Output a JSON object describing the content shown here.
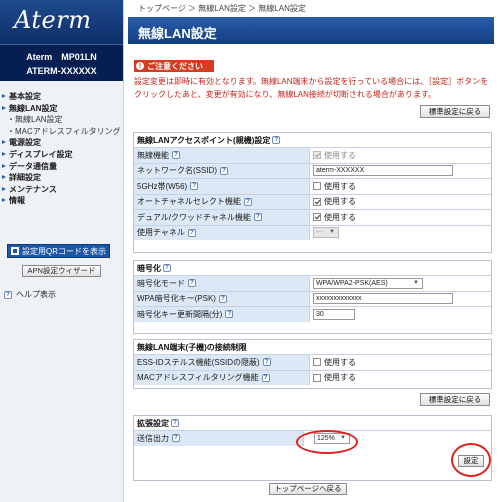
{
  "sidebar": {
    "logo": "Aterm",
    "model": "Aterm　MP01LN",
    "device_id": "ATERM-XXXXXX",
    "nav": [
      {
        "label": "基本設定"
      },
      {
        "label": "無線LAN設定"
      },
      {
        "label": "電源設定"
      },
      {
        "label": "ディスプレイ設定"
      },
      {
        "label": "データ通信量"
      },
      {
        "label": "詳細設定"
      },
      {
        "label": "メンテナンス"
      },
      {
        "label": "情報"
      }
    ],
    "sub_items": [
      "・無線LAN設定",
      "・MACアドレスフィルタリング"
    ],
    "qr_button": "設定用QRコードを表示",
    "apn_button": "APN設定ウィザード",
    "help_toggle": "ヘルプ表示"
  },
  "breadcrumb": "トップページ ＞ 無線LAN設定 ＞ 無線LAN設定",
  "page_title": "無線LAN設定",
  "notice": {
    "title": "ご注意ください",
    "text": "設定変更は即時に有効となります。無線LAN端末から設定を行っている場合には、［設定］ボタンをクリックしたあと、変更が有効になり、無線LAN接続が切断される場合があります。"
  },
  "buttons": {
    "reset": "標準設定に戻る",
    "set": "設定",
    "back_to_top": "トップページへ戻る"
  },
  "sections": {
    "ap": {
      "title": "無線LANアクセスポイント(親機)設定",
      "rows": {
        "wireless": {
          "label": "無線機能",
          "value": "使用する",
          "checked": true,
          "disabled": true
        },
        "ssid": {
          "label": "ネットワーク名(SSID)",
          "value": "aterm-XXXXXX"
        },
        "band5g": {
          "label": "5GHz帯(W56)",
          "value": "使用する",
          "checked": false
        },
        "auto_channel": {
          "label": "オートチャネルセレクト機能",
          "value": "使用する",
          "checked": true
        },
        "dual_cloud": {
          "label": "デュアル/クワッドチャネル機能",
          "value": "使用する",
          "checked": true
        },
        "channel": {
          "label": "使用チャネル",
          "value": "---"
        }
      }
    },
    "enc": {
      "title": "暗号化",
      "rows": {
        "mode": {
          "label": "暗号化モード",
          "value": "WPA/WPA2-PSK(AES)"
        },
        "psk": {
          "label": "WPA暗号化キー(PSK)",
          "value": "xxxxxxxxxxxxx"
        },
        "interval": {
          "label": "暗号化キー更新間隔(分)",
          "value": "30"
        }
      }
    },
    "acl": {
      "title": "無線LAN端末(子機)の接続制限",
      "rows": {
        "stealth": {
          "label": "ESS-IDステルス機能(SSIDの隠蔽)",
          "value": "使用する",
          "checked": false
        },
        "macfilter": {
          "label": "MACアドレスフィルタリング機能",
          "value": "使用する",
          "checked": false
        }
      }
    },
    "ext": {
      "title": "拡張設定",
      "rows": {
        "tx_power": {
          "label": "送信出力",
          "value": "125%"
        }
      }
    }
  },
  "help_mark": "?",
  "colors": {
    "title_bar": "#1a4a93",
    "notice_red": "#c4221a",
    "label_bg": "#dde8f6",
    "highlight_ring": "#e0201a"
  }
}
